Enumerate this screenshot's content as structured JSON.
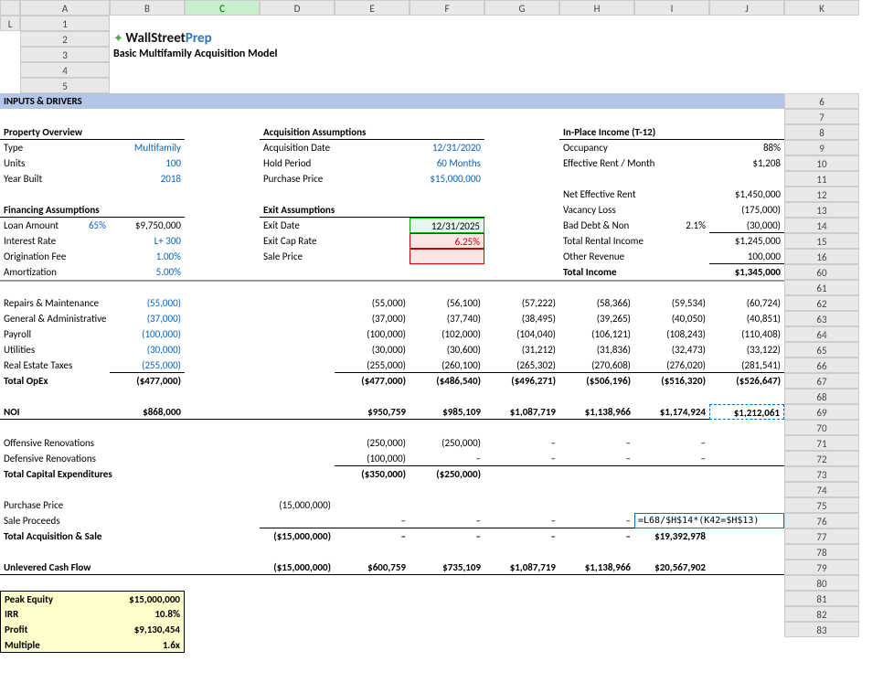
{
  "cols": [
    "A",
    "B",
    "C",
    "D",
    "E",
    "F",
    "G",
    "H",
    "I",
    "J",
    "K",
    "L"
  ],
  "rows_top": [
    "1",
    "2",
    "3",
    "4",
    "5",
    "6",
    "7",
    "8",
    "9",
    "10",
    "11",
    "12",
    "13",
    "14",
    "15",
    "16"
  ],
  "rows_bottom": [
    "60",
    "61",
    "62",
    "63",
    "64",
    "65",
    "66",
    "67",
    "68",
    "69",
    "70",
    "71",
    "72",
    "73",
    "74",
    "75",
    "76",
    "77",
    "78",
    "79",
    "80",
    "81",
    "82",
    "83"
  ],
  "logo_a": "WallStreet",
  "logo_b": "Prep",
  "subtitle": "Basic Multifamily Acquisition Model",
  "inputs_hdr": "INPUTS & DRIVERS",
  "prop_hdr": "Property Overview",
  "prop_type_lbl": "Type",
  "prop_type_val": "Multifamily",
  "prop_units_lbl": "Units",
  "prop_units_val": "100",
  "prop_year_lbl": "Year Built",
  "prop_year_val": "2018",
  "fin_hdr": "Financing Assumptions",
  "loan_lbl": "Loan Amount",
  "loan_pct": "65%",
  "loan_val": "$9,750,000",
  "rate_lbl": "Interest Rate",
  "rate_val": "L+ 300",
  "orig_lbl": "Origination Fee",
  "orig_val": "1.00%",
  "amort_lbl": "Amortization",
  "amort_val": "5.00%",
  "acq_hdr": "Acquisition Assumptions",
  "acq_date_lbl": "Acquisition Date",
  "acq_date_val": "12/31/2020",
  "hold_lbl": "Hold Period",
  "hold_val": "60 Months",
  "pp_lbl": "Purchase Price",
  "pp_val": "$15,000,000",
  "exit_hdr": "Exit Assumptions",
  "exit_date_lbl": "Exit Date",
  "exit_date_val": "12/31/2025",
  "exit_cap_lbl": "Exit Cap Rate",
  "exit_cap_val": "6.25%",
  "sale_price_lbl": "Sale Price",
  "inplace_hdr": "In-Place Income (T-12)",
  "occ_lbl": "Occupancy",
  "occ_val": "88%",
  "rent_lbl": "Effective Rent / Month",
  "rent_val": "$1,208",
  "ner_lbl": "Net Effective Rent",
  "ner_val": "$1,450,000",
  "vac_lbl": "Vacancy Loss",
  "vac_val": "(175,000)",
  "bad_lbl": "Bad Debt & Non",
  "bad_pct": "2.1%",
  "bad_val": "(30,000)",
  "tri_lbl": "Total Rental Income",
  "tri_val": "$1,245,000",
  "other_lbl": "Other Revenue",
  "other_val": "100,000",
  "ti_lbl": "Total Income",
  "ti_val": "$1,345,000",
  "op_rows": [
    {
      "lbl": "Repairs & Maintenance",
      "d": "(55,000)",
      "g": "(55,000)",
      "h": "(56,100)",
      "i": "(57,222)",
      "j": "(58,366)",
      "k": "(59,534)",
      "l": "(60,724)"
    },
    {
      "lbl": "General & Administrative",
      "d": "(37,000)",
      "g": "(37,000)",
      "h": "(37,740)",
      "i": "(38,495)",
      "j": "(39,265)",
      "k": "(40,050)",
      "l": "(40,851)"
    },
    {
      "lbl": "Payroll",
      "d": "(100,000)",
      "g": "(100,000)",
      "h": "(102,000)",
      "i": "(104,040)",
      "j": "(106,121)",
      "k": "(108,243)",
      "l": "(110,408)"
    },
    {
      "lbl": "Utilities",
      "d": "(30,000)",
      "g": "(30,000)",
      "h": "(30,600)",
      "i": "(31,212)",
      "j": "(31,836)",
      "k": "(32,473)",
      "l": "(33,122)"
    },
    {
      "lbl": "Real Estate Taxes",
      "d": "(255,000)",
      "g": "(255,000)",
      "h": "(260,100)",
      "i": "(265,302)",
      "j": "(270,608)",
      "k": "(276,020)",
      "l": "(281,541)"
    }
  ],
  "opex_total_lbl": "Total OpEx",
  "opex_total": {
    "d": "($477,000)",
    "g": "($477,000)",
    "h": "($486,540)",
    "i": "($496,271)",
    "j": "($506,196)",
    "k": "($516,320)",
    "l": "($526,647)"
  },
  "noi_lbl": "NOI",
  "noi": {
    "d": "$868,000",
    "g": "$950,759",
    "h": "$985,109",
    "i": "$1,087,719",
    "j": "$1,138,966",
    "k": "$1,174,924",
    "l": "$1,212,061"
  },
  "off_lbl": "Offensive Renovations",
  "off": {
    "g": "(250,000)",
    "h": "(250,000)",
    "i": "–",
    "j": "–",
    "k": "–"
  },
  "def_lbl": "Defensive Renovations",
  "def": {
    "g": "(100,000)",
    "h": "–",
    "i": "–",
    "j": "–",
    "k": "–"
  },
  "capex_lbl": "Total Capital Expenditures",
  "capex": {
    "g": "($350,000)",
    "h": "($250,000)"
  },
  "pp2_lbl": "Purchase Price",
  "pp2_val": "(15,000,000)",
  "sp_lbl": "Sale Proceeds",
  "sp": {
    "g": "–",
    "h": "–",
    "i": "–",
    "j": "–"
  },
  "formula": "=L68/$H$14*(K42=$H$13)",
  "taq_lbl": "Total Acquisition & Sale",
  "taq": {
    "f": "($15,000,000)",
    "g": "–",
    "h": "–",
    "i": "–",
    "j": "–",
    "k": "$19,392,978"
  },
  "ucf_lbl": "Unlevered Cash Flow",
  "ucf": {
    "f": "($15,000,000)",
    "g": "$600,759",
    "h": "$735,109",
    "i": "$1,087,719",
    "j": "$1,138,966",
    "k": "$20,567,902"
  },
  "peak_lbl": "Peak Equity",
  "peak_val": "$15,000,000",
  "irr_lbl": "IRR",
  "irr_val": "10.8%",
  "profit_lbl": "Profit",
  "profit_val": "$9,130,454",
  "mult_lbl": "Multiple",
  "mult_val": "1.6x"
}
